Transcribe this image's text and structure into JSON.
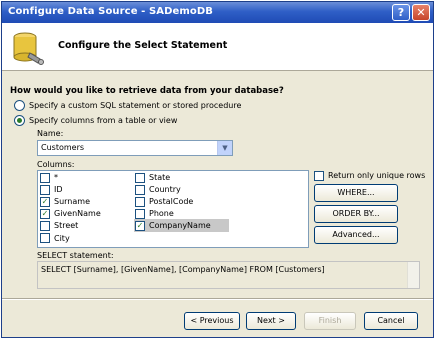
{
  "window": {
    "title": "Configure Data Source - SADemoDB",
    "help_glyph": "?",
    "close_glyph": "✕"
  },
  "header": {
    "heading": "Configure the Select Statement",
    "icon": "database-icon"
  },
  "question": "How would you like to retrieve data from your database?",
  "radios": [
    {
      "label": "Specify a custom SQL statement or stored procedure",
      "checked": false
    },
    {
      "label": "Specify columns from a table or view",
      "checked": true
    }
  ],
  "name_field": {
    "label": "Name:",
    "value": "Customers"
  },
  "columns": {
    "label": "Columns:",
    "left": [
      {
        "name": "*",
        "checked": false
      },
      {
        "name": "ID",
        "checked": false
      },
      {
        "name": "Surname",
        "checked": true
      },
      {
        "name": "GivenName",
        "checked": true
      },
      {
        "name": "Street",
        "checked": false
      },
      {
        "name": "City",
        "checked": false
      }
    ],
    "right": [
      {
        "name": "State",
        "checked": false
      },
      {
        "name": "Country",
        "checked": false
      },
      {
        "name": "PostalCode",
        "checked": false
      },
      {
        "name": "Phone",
        "checked": false
      },
      {
        "name": "CompanyName",
        "checked": true
      }
    ]
  },
  "unique_rows": {
    "label": "Return only unique rows",
    "checked": false
  },
  "side_buttons": {
    "where": "WHERE...",
    "order_by": "ORDER BY...",
    "advanced": "Advanced..."
  },
  "select_statement": {
    "label": "SELECT statement:",
    "value": "SELECT [Surname], [GivenName], [CompanyName] FROM [Customers]"
  },
  "footer": {
    "previous": "< Previous",
    "next": "Next >",
    "finish": "Finish",
    "cancel": "Cancel"
  }
}
